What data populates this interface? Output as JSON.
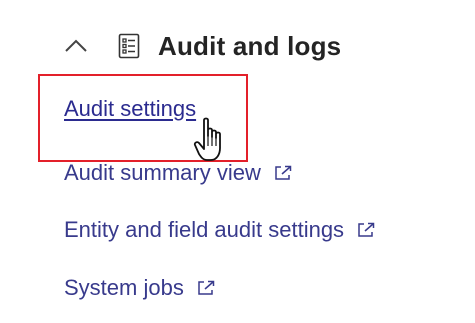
{
  "section": {
    "title": "Audit and logs",
    "expanded": true,
    "chevron_icon": "chevron-up-icon",
    "section_icon": "checklist-icon"
  },
  "items": [
    {
      "label": "Audit settings",
      "external": false,
      "active": true
    },
    {
      "label": "Audit summary view",
      "external": true
    },
    {
      "label": "Entity and field audit settings",
      "external": true
    },
    {
      "label": "System jobs",
      "external": true
    }
  ],
  "icons": {
    "external": "open-in-new-window-icon",
    "cursor": "hand-pointer-icon"
  },
  "colors": {
    "link": "#383a8c",
    "title": "#242424",
    "highlight": "#e3202a"
  }
}
